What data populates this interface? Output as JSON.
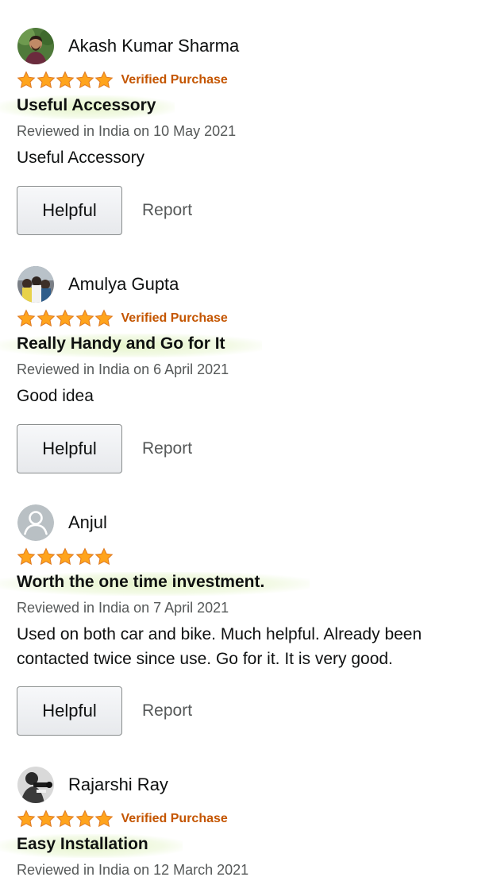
{
  "reviews": [
    {
      "reviewer": "Akash Kumar Sharma",
      "avatar_icon": "profile-photo",
      "stars": 5,
      "verified_label": "Verified Purchase",
      "title": "Useful Accessory",
      "date": "Reviewed in India on 10 May 2021",
      "body": "Useful Accessory",
      "helpful_label": "Helpful",
      "report_label": "Report"
    },
    {
      "reviewer": "Amulya Gupta",
      "avatar_icon": "profile-photo",
      "stars": 5,
      "verified_label": "Verified Purchase",
      "title": "Really Handy and Go for It",
      "date": "Reviewed in India on 6 April 2021",
      "body": "Good idea",
      "helpful_label": "Helpful",
      "report_label": "Report"
    },
    {
      "reviewer": "Anjul",
      "avatar_icon": "default-user-icon",
      "stars": 5,
      "verified_label": "",
      "title": "Worth the one time investment.",
      "date": "Reviewed in India on 7 April 2021",
      "body": "Used on both car and bike. Much helpful. Already been contacted twice since use. Go for it. It is very good.",
      "helpful_label": "Helpful",
      "report_label": "Report"
    },
    {
      "reviewer": "Rajarshi Ray",
      "avatar_icon": "profile-photo",
      "stars": 5,
      "verified_label": "Verified Purchase",
      "title": "Easy Installation",
      "date": "Reviewed in India on 12 March 2021",
      "body": "",
      "helpful_label": "",
      "report_label": ""
    }
  ],
  "colors": {
    "star": "#ffa41c",
    "verified": "#c45500",
    "highlight": "#e4f3c8"
  }
}
